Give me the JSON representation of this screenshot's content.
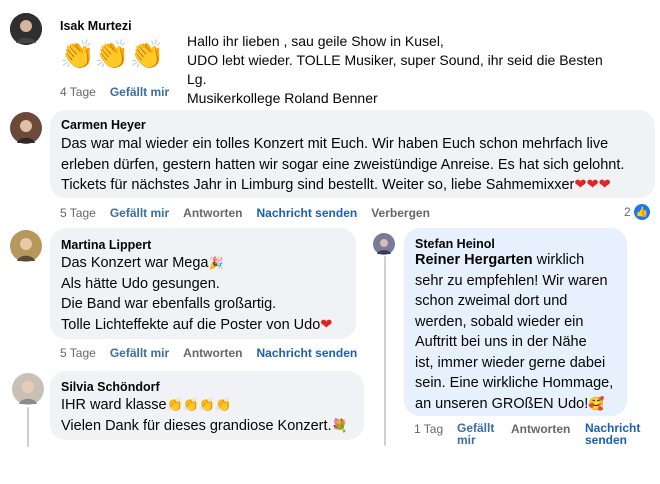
{
  "colors": {
    "bubble": "#f0f2f5",
    "bubble_reply": "#e7f0fd",
    "link": "#1b5fb4",
    "meta": "#65676b",
    "like_blue": "#1877f2"
  },
  "comments": [
    {
      "author": "Isak Murtezi",
      "claps": "👏👏👏",
      "side_lines": [
        "Hallo ihr lieben , sau geile Show in Kusel,",
        "UDO lebt wieder. TOLLE Musiker, super Sound,  ihr seid die Besten",
        "Lg.",
        "Musikerkollege Roland Benner"
      ],
      "time": "4 Tage",
      "like": "Gefällt mir"
    },
    {
      "author": "Carmen Heyer",
      "lines": [
        "Das war mal wieder ein tolles Konzert mit Euch. Wir haben Euch schon mehrfach live",
        "erleben dürfen, gestern hatten wir sogar eine zweistündige Anreise. Es hat sich gelohnt.",
        "Tickets für nächstes Jahr in Limburg sind bestellt. Weiter so, liebe Sahmemixxer"
      ],
      "hearts": "❤❤❤",
      "time": "5 Tage",
      "like": "Gefällt mir",
      "reply": "Antworten",
      "message": "Nachricht senden",
      "hide": "Verbergen",
      "reactions": "2"
    },
    {
      "author": "Martina Lippert",
      "lines": [
        "Das Konzert war Mega",
        "Als hätte Udo gesungen.",
        "Die Band war ebenfalls großartig.",
        "Tolle Lichteffekte auf die Poster von Udo"
      ],
      "party": "🎉",
      "heart": "❤",
      "time": "5 Tage",
      "like": "Gefällt mir",
      "reply": "Antworten",
      "message": "Nachricht senden"
    },
    {
      "author": "Silvia Schöndorf",
      "lines": [
        "IHR ward klasse",
        "Vielen Dank für dieses grandiose Konzert."
      ],
      "claps": "👏👏👏👏",
      "bouquet": "💐"
    },
    {
      "author": "Stefan Heinol",
      "mention": "Reiner Hergarten",
      "first_rest": " wirklich",
      "lines": [
        "sehr zu empfehlen! Wir waren",
        "schon zweimal dort und",
        "werden, sobald wieder ein",
        "Auftritt bei uns in der Nähe",
        "ist, immer wieder gerne dabei",
        "sein. Eine wirkliche Hommage,",
        "an unseren GROßEN Udo!"
      ],
      "emoji": "🥰",
      "time": "1 Tag",
      "like_l1": "Gefällt",
      "like_l2": "mir",
      "reply": "Antworten",
      "message_l1": "Nachricht",
      "message_l2": "senden"
    }
  ]
}
